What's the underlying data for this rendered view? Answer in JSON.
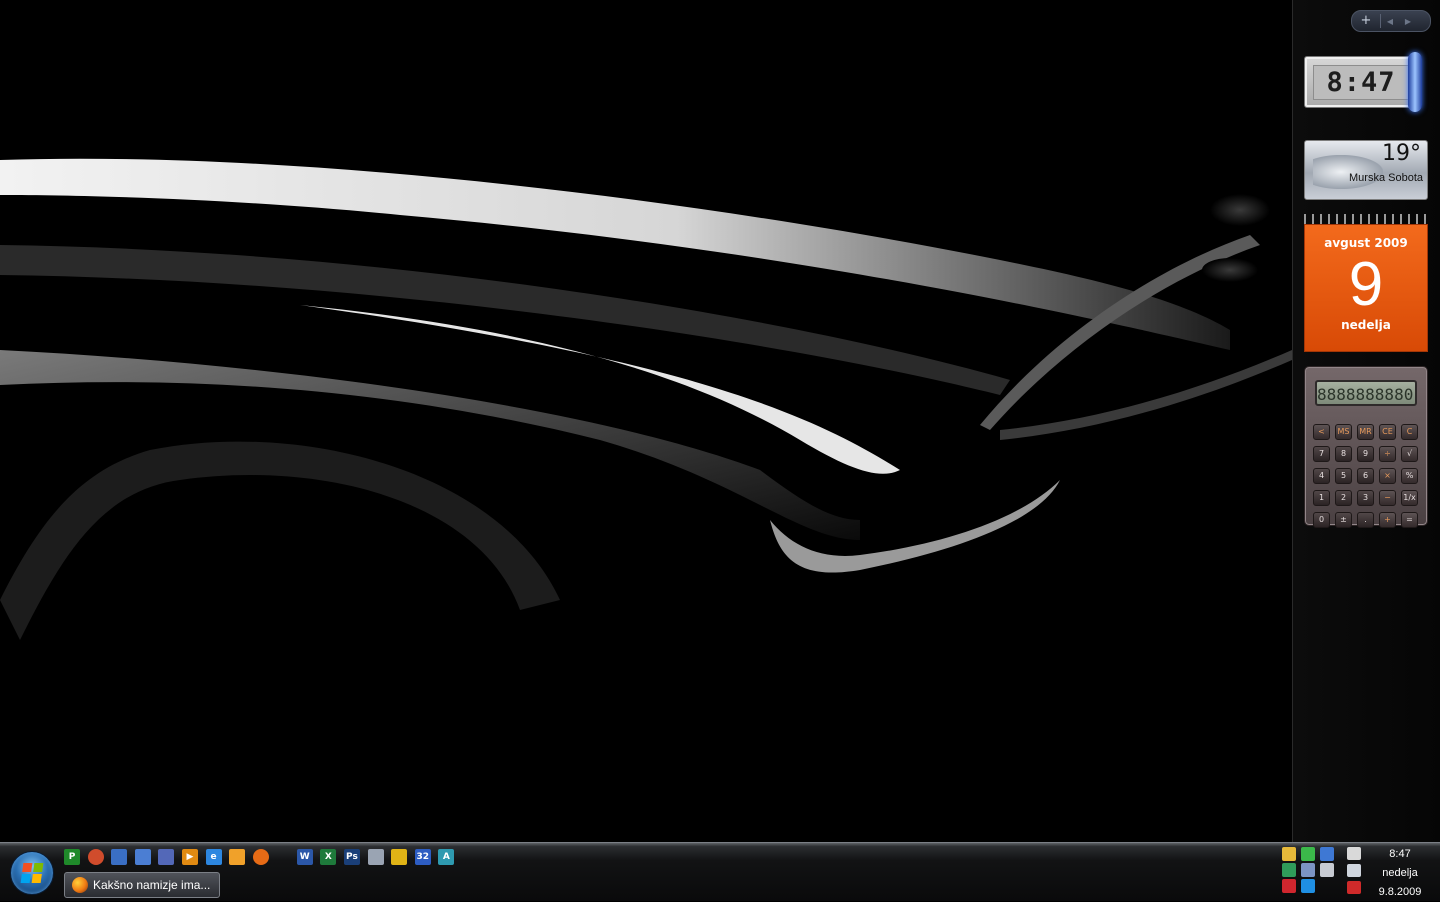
{
  "sidebar": {
    "controls": {
      "add_label": "+",
      "prev_label": "◀",
      "next_label": "▶"
    },
    "clock": {
      "time": "8:47"
    },
    "weather": {
      "temperature": "19°",
      "city": "Murska Sobota"
    },
    "calendar": {
      "month_year": "avgust 2009",
      "day": "9",
      "weekday": "nedelja"
    },
    "calculator": {
      "display": "8888888880",
      "keys": [
        {
          "label": "<",
          "kind": "ops"
        },
        {
          "label": "MS",
          "kind": "ops"
        },
        {
          "label": "MR",
          "kind": "ops"
        },
        {
          "label": "CE",
          "kind": "ops"
        },
        {
          "label": "C",
          "kind": "ops"
        },
        {
          "label": "7",
          "kind": "num"
        },
        {
          "label": "8",
          "kind": "num"
        },
        {
          "label": "9",
          "kind": "num"
        },
        {
          "label": "÷",
          "kind": "ops"
        },
        {
          "label": "√",
          "kind": "plain"
        },
        {
          "label": "4",
          "kind": "num"
        },
        {
          "label": "5",
          "kind": "num"
        },
        {
          "label": "6",
          "kind": "num"
        },
        {
          "label": "×",
          "kind": "ops"
        },
        {
          "label": "%",
          "kind": "plain"
        },
        {
          "label": "1",
          "kind": "num"
        },
        {
          "label": "2",
          "kind": "num"
        },
        {
          "label": "3",
          "kind": "num"
        },
        {
          "label": "−",
          "kind": "ops"
        },
        {
          "label": "1/x",
          "kind": "plain"
        },
        {
          "label": "0",
          "kind": "num"
        },
        {
          "label": "±",
          "kind": "num"
        },
        {
          "label": ".",
          "kind": "num"
        },
        {
          "label": "+",
          "kind": "ops"
        },
        {
          "label": "=",
          "kind": "plain"
        }
      ]
    }
  },
  "taskbar": {
    "quick_launch": [
      {
        "name": "project-icon",
        "glyph": "P",
        "color": "#1f8a2a"
      },
      {
        "name": "tools-icon",
        "glyph": "",
        "color": "#d04c2c",
        "round": true
      },
      {
        "name": "show-desktop-icon",
        "glyph": "",
        "color": "#3a6fc4"
      },
      {
        "name": "switch-windows-icon",
        "glyph": "",
        "color": "#4b7ed3"
      },
      {
        "name": "cube-app-icon",
        "glyph": "",
        "color": "#5368b8"
      },
      {
        "name": "media-player-icon",
        "glyph": "▶",
        "color": "#e08a12"
      },
      {
        "name": "internet-explorer-icon",
        "glyph": "e",
        "color": "#2d87e0"
      },
      {
        "name": "mail-icon",
        "glyph": "",
        "color": "#f0a12a"
      },
      {
        "name": "firefox-icon",
        "glyph": "",
        "color": "#e66b16",
        "round": true,
        "gap": true
      },
      {
        "name": "word-icon",
        "glyph": "W",
        "color": "#2b57a8"
      },
      {
        "name": "excel-icon",
        "glyph": "X",
        "color": "#1e7a3b"
      },
      {
        "name": "photoshop-icon",
        "glyph": "Ps",
        "color": "#1a3f78"
      },
      {
        "name": "network-app-icon",
        "glyph": "",
        "color": "#9aa4b3"
      },
      {
        "name": "linux-icon",
        "glyph": "",
        "color": "#e0b416"
      },
      {
        "name": "asp32-icon",
        "glyph": "32",
        "color": "#2d5dc2"
      },
      {
        "name": "text-app-icon",
        "glyph": "A",
        "color": "#2e9ab0"
      }
    ],
    "task_window": {
      "label": "Kakšno namizje ima..."
    },
    "tray_icons": [
      {
        "name": "tray-msn-icon",
        "color": "#e6b93a"
      },
      {
        "name": "tray-check-icon",
        "color": "#3bb84a"
      },
      {
        "name": "tray-network-icon",
        "color": "#3e78d4"
      },
      {
        "name": "tray-shield-icon",
        "color": "#2f9c5a"
      },
      {
        "name": "tray-document-icon",
        "color": "#7c94c4"
      },
      {
        "name": "tray-printer-icon",
        "color": "#c7cbd2"
      },
      {
        "name": "tray-antivirus-icon",
        "color": "#d0262e"
      },
      {
        "name": "tray-skype-icon",
        "color": "#1f8fe3"
      }
    ],
    "tray_system": [
      {
        "name": "tray-phone-icon",
        "color": "#d9d9d9"
      },
      {
        "name": "tray-display-icon",
        "color": "#cfd5de"
      },
      {
        "name": "volume-muted-icon",
        "color": "#cf2a2a"
      }
    ],
    "clock": {
      "time": "8:47",
      "weekday": "nedelja",
      "date": "9.8.2009"
    }
  }
}
